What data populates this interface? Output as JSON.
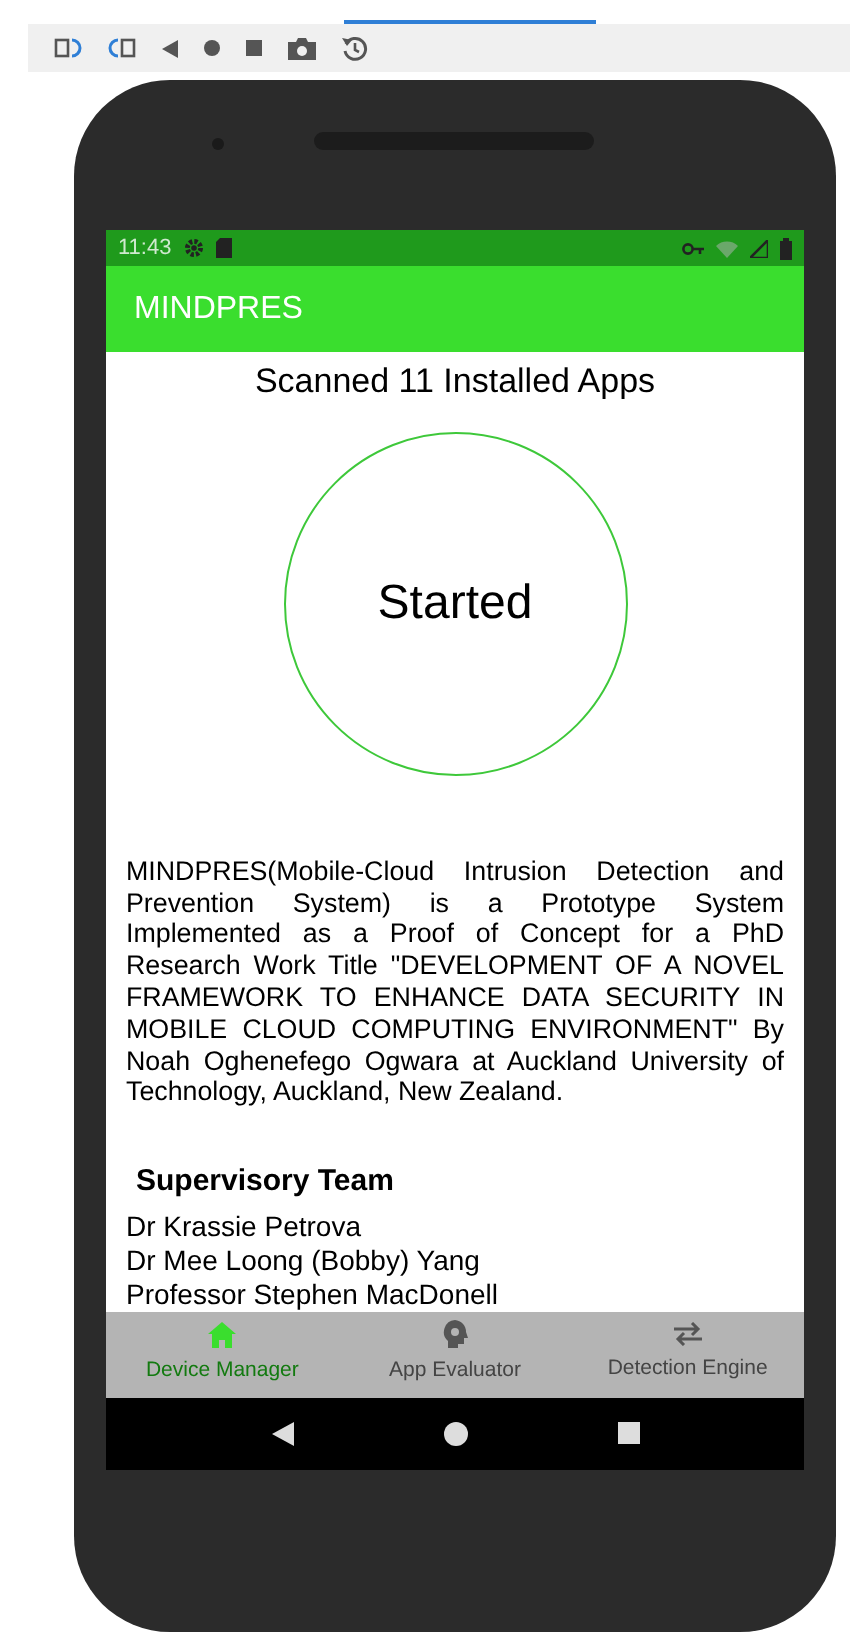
{
  "status_bar": {
    "time": "11:43"
  },
  "app_bar": {
    "title": "MINDPRES"
  },
  "scan_status": "Scanned 11 Installed Apps",
  "circle_label": "Started",
  "description": "MINDPRES(Mobile-Cloud Intrusion Detection and Prevention System) is a Prototype System Implemented as a Proof of Concept for a PhD Research Work Title \"DEVELOPMENT OF A NOVEL FRAMEWORK TO ENHANCE DATA SECURITY IN MOBILE CLOUD COMPUTING ENVIRONMENT\" By Noah Oghenefego Ogwara at Auckland University of Technology, Auckland, New Zealand.",
  "team": {
    "heading": "Supervisory Team",
    "members": [
      "Dr Krassie Petrova",
      "Dr Mee Loong (Bobby) Yang",
      "Professor Stephen MacDonell"
    ]
  },
  "tabs": [
    {
      "kind": "home",
      "label": "Device Manager",
      "selected": true
    },
    {
      "kind": "evaluator",
      "label": "App Evaluator",
      "selected": false
    },
    {
      "kind": "engine",
      "label": "Detection Engine",
      "selected": false
    }
  ]
}
